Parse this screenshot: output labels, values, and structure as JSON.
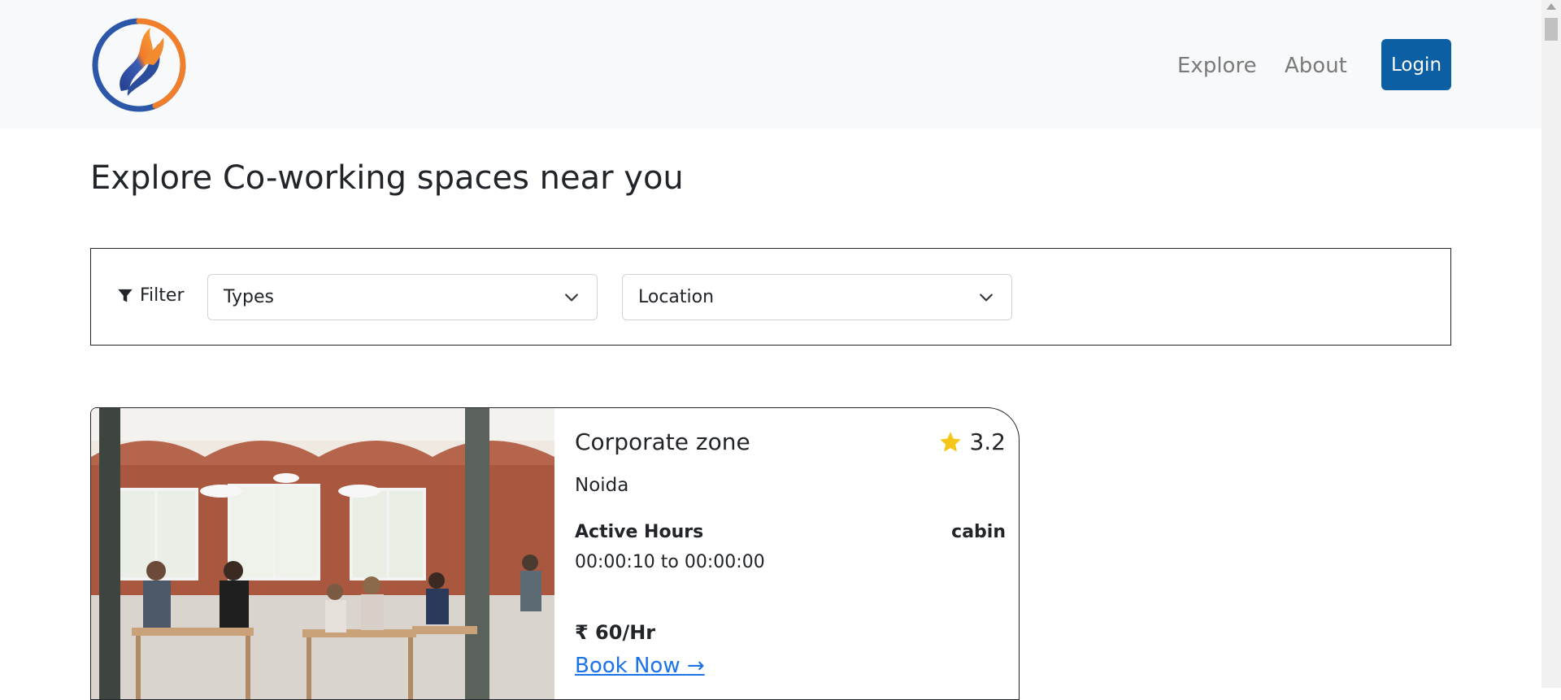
{
  "nav": {
    "logo_icon": "swirl-logo",
    "explore_label": "Explore",
    "about_label": "About",
    "login_label": "Login",
    "login_color": "#0d5fa3"
  },
  "page": {
    "title": "Explore Co-working spaces near you"
  },
  "filter": {
    "icon": "filter-icon",
    "label": "Filter",
    "types_select": {
      "value": "Types"
    },
    "location_select": {
      "value": "Location"
    }
  },
  "listings": [
    {
      "name": "Corporate zone",
      "rating": "3.2",
      "rating_icon": "star-icon",
      "star_color": "#f5c518",
      "city": "Noida",
      "hours_label": "Active Hours",
      "hours": "00:00:10 to 00:00:00",
      "space_type": "cabin",
      "price": "₹ 60/Hr",
      "book_label": "Book Now ",
      "book_arrow": "→",
      "image": "office-photo"
    }
  ],
  "colors": {
    "nav_bg": "#f8f9fa",
    "link": "#1a73e8",
    "text": "#212529"
  }
}
